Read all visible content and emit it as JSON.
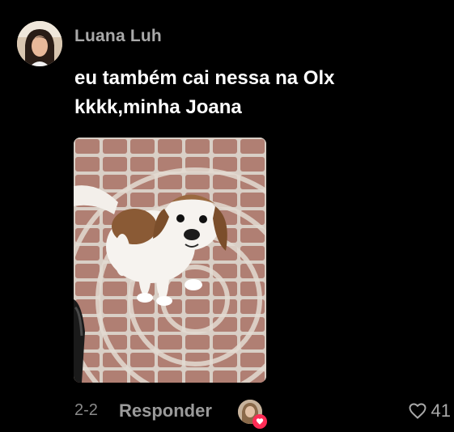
{
  "comment": {
    "author": "Luana Luh",
    "text_line1": "eu também cai nessa na Olx",
    "text_line2": "kkkk,minha Joana",
    "date": "2-2",
    "reply_label": "Responder",
    "like_count": "41"
  },
  "colors": {
    "background": "#000000",
    "author": "#a9a9a9",
    "text": "#ffffff",
    "muted": "#8a8a8a",
    "heart_badge": "#fe2c55"
  },
  "icons": {
    "like": "heart-outline-icon",
    "badge": "heart-filled-icon"
  }
}
